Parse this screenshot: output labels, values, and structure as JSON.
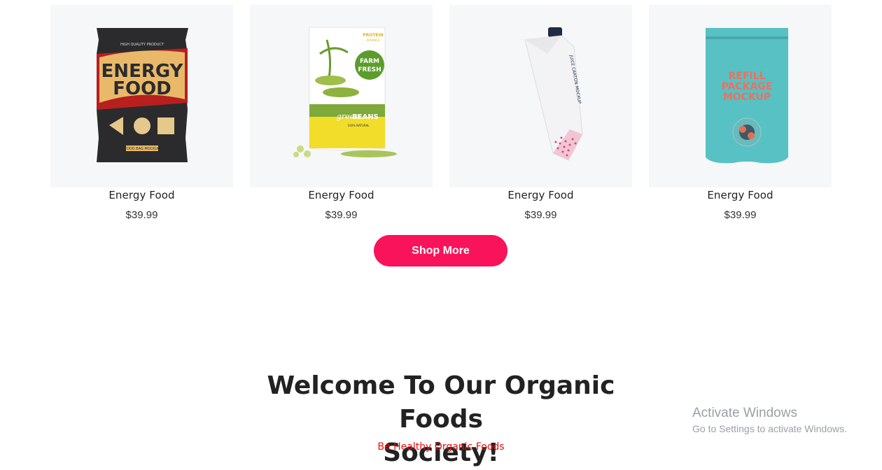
{
  "products": [
    {
      "name": "Energy Food",
      "price": "$39.99",
      "image_icon": "energy-food-bag-icon"
    },
    {
      "name": "Energy Food",
      "price": "$39.99",
      "image_icon": "green-beans-pouch-icon"
    },
    {
      "name": "Energy Food",
      "price": "$39.99",
      "image_icon": "juice-carton-icon"
    },
    {
      "name": "Energy Food",
      "price": "$39.99",
      "image_icon": "refill-pouch-icon"
    }
  ],
  "shop_more_label": "Shop More",
  "welcome": {
    "title_line1": "Welcome To Our Organic Foods",
    "title_line2": "Society!",
    "subtitle": "Be Healthy Organic Foods"
  },
  "package_text": {
    "p1_top": "HIGH QUALITY PRODUCT",
    "p1_line1": "ENERGY",
    "p1_line2": "FOOD",
    "p1_bottom": "FOOD BAG MOCKUP",
    "p2_badge1": "FARM",
    "p2_badge2": "FRESH",
    "p2_corner1": "PROTEIN",
    "p2_corner2": "ADVANCE",
    "p2_green": "green",
    "p2_beans": "BEANS",
    "p2_natural": "100% NATURAL",
    "p3_side": "JUICE CARTON MOCKUP",
    "p4_line1": "REFILL",
    "p4_line2": "PACKAGE",
    "p4_line3": "MOCKUP"
  },
  "colors": {
    "accent": "#f8135a",
    "subtitle": "#e81010",
    "card_bg": "#f6f7f9"
  },
  "watermark": {
    "title": "Activate Windows",
    "subtitle": "Go to Settings to activate Windows."
  }
}
